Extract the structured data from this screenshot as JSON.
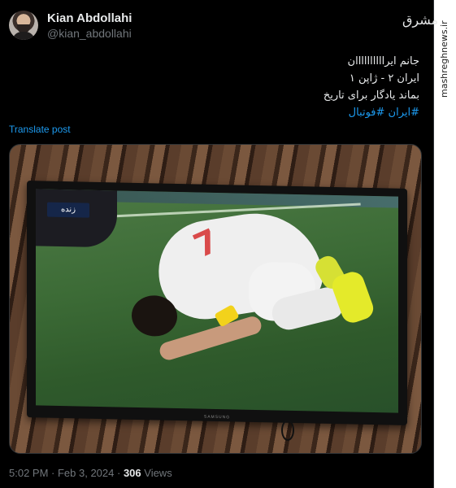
{
  "author": {
    "name": "Kian Abdollahi",
    "handle": "@kian_abdollahi"
  },
  "tweet": {
    "lines": [
      "جانم ایراااااااااان",
      "ایران ۲ - ژاپن ۱",
      "بماند یادگار برای تاریخ"
    ],
    "hashtags": "#ایران #فوتبال"
  },
  "translate_label": "Translate post",
  "media": {
    "channel_logo": "زنده",
    "tv_brand": "SAMSUNG"
  },
  "meta": {
    "time": "5:02 PM",
    "date": "Feb 3, 2024",
    "separator": " · ",
    "views_count": "306",
    "views_label": " Views"
  },
  "watermark": {
    "logo": "مشرق",
    "url": "mashreghnews.ir"
  },
  "colors": {
    "accent": "#1d9bf0",
    "background": "#000000",
    "muted": "#71767b"
  }
}
